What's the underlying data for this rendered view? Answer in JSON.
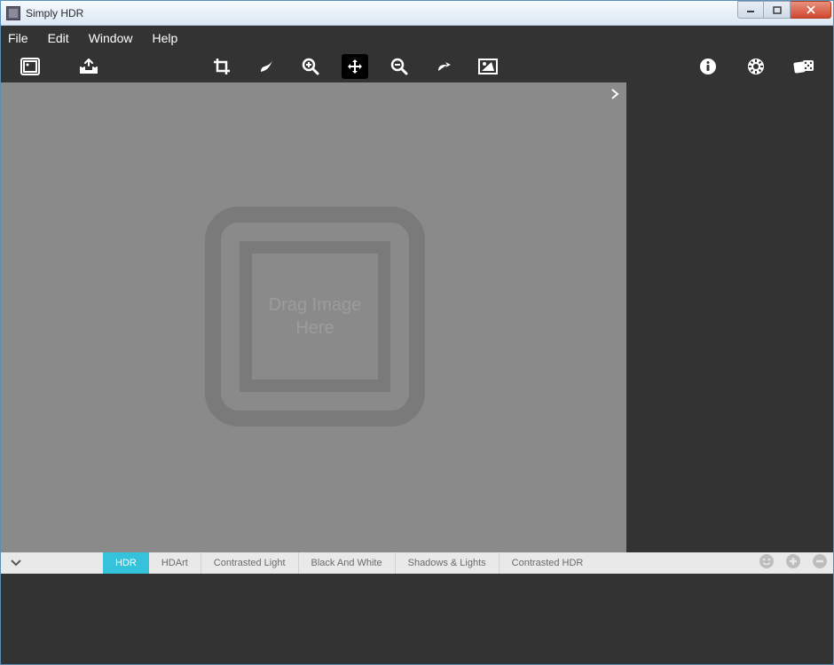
{
  "titlebar": {
    "title": "Simply HDR"
  },
  "menubar": {
    "items": [
      "File",
      "Edit",
      "Window",
      "Help"
    ]
  },
  "toolbar": {
    "left": [
      {
        "name": "open-image-icon"
      },
      {
        "name": "save-image-icon"
      }
    ],
    "center": [
      {
        "name": "crop-icon",
        "active": false
      },
      {
        "name": "brush-icon",
        "active": false
      },
      {
        "name": "zoom-in-icon",
        "active": false
      },
      {
        "name": "pan-icon",
        "active": true
      },
      {
        "name": "zoom-out-icon",
        "active": false
      },
      {
        "name": "redo-icon",
        "active": false
      },
      {
        "name": "compare-icon",
        "active": false
      }
    ],
    "right": [
      {
        "name": "info-icon"
      },
      {
        "name": "settings-icon"
      },
      {
        "name": "random-icon"
      }
    ]
  },
  "canvas": {
    "drop_text_line1": "Drag Image",
    "drop_text_line2": "Here"
  },
  "filterbar": {
    "tabs": [
      {
        "label": "HDR",
        "active": true
      },
      {
        "label": "HDArt",
        "active": false
      },
      {
        "label": "Contrasted Light",
        "active": false
      },
      {
        "label": "Black And White",
        "active": false
      },
      {
        "label": "Shadows & Lights",
        "active": false
      },
      {
        "label": "Contrasted HDR",
        "active": false
      }
    ]
  },
  "colors": {
    "accent": "#35c3dc",
    "dark_bg": "#333333",
    "canvas_bg": "#8a8a8a"
  }
}
